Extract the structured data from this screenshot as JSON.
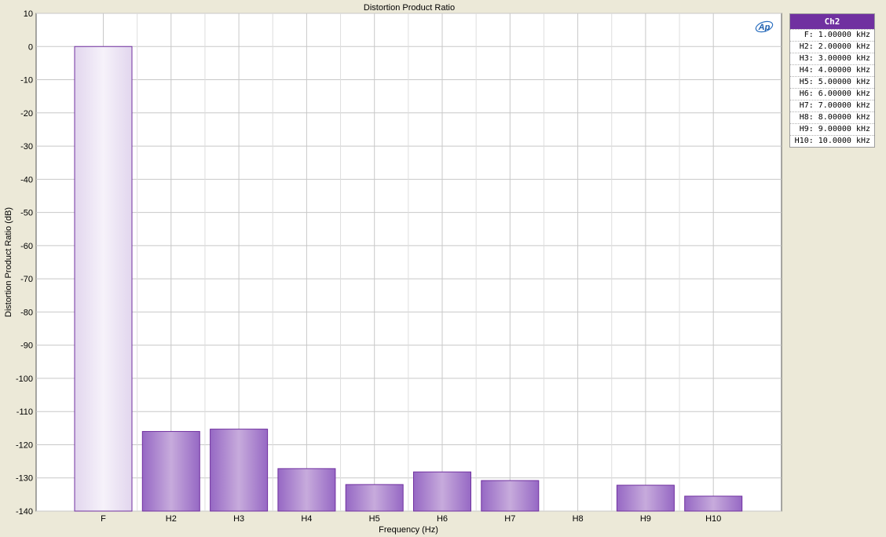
{
  "chart_data": {
    "type": "bar",
    "title": "Distortion Product Ratio",
    "xlabel": "Frequency (Hz)",
    "ylabel": "Distortion Product Ratio (dB)",
    "categories": [
      "F",
      "H2",
      "H3",
      "H4",
      "H5",
      "H6",
      "H7",
      "H8",
      "H9",
      "H10"
    ],
    "series": [
      {
        "name": "Ch2",
        "values": [
          0,
          -116,
          -115.3,
          -127.2,
          -132,
          -128.2,
          -130.8,
          null,
          -132.2,
          -135.5
        ]
      }
    ],
    "ylim": [
      -140,
      10
    ],
    "yticks": [
      10,
      0,
      -10,
      -20,
      -30,
      -40,
      -50,
      -60,
      -70,
      -80,
      -90,
      -100,
      -110,
      -120,
      -130,
      -140
    ],
    "grid": true,
    "legend_position": "right"
  },
  "colors": {
    "panel_bg": "#ece9d8",
    "plot_bg": "#ffffff",
    "grid": "#c8c8c8",
    "bar_stroke": "#7030a0",
    "bar_fill_edge": "#9668c4",
    "bar_fill_center": "#c7abdc",
    "fundamental_fill_edge": "#e2d6ee",
    "fundamental_fill_center": "#f6f2fa",
    "legend_header": "#7030a0"
  },
  "logo": {
    "text": "Ap",
    "icon": "ap-logo-icon"
  },
  "legend": {
    "header": "Ch2",
    "rows": [
      "F: 1.00000 kHz",
      "H2: 2.00000 kHz",
      "H3: 3.00000 kHz",
      "H4: 4.00000 kHz",
      "H5: 5.00000 kHz",
      "H6: 6.00000 kHz",
      "H7: 7.00000 kHz",
      "H8: 8.00000 kHz",
      "H9: 9.00000 kHz",
      "H10: 10.0000 kHz"
    ]
  }
}
